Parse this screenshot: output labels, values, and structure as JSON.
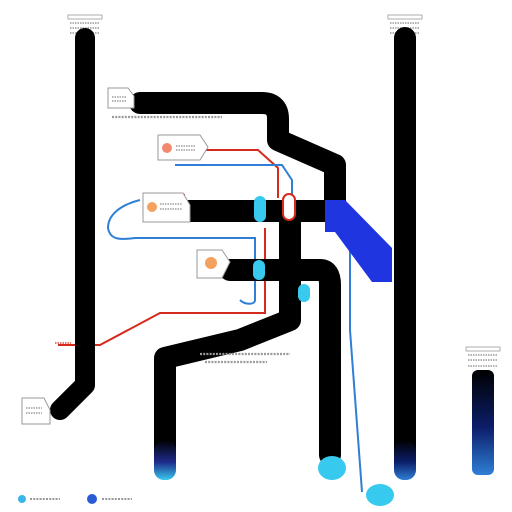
{
  "diagram": {
    "type": "pipe-routing-schematic",
    "colors": {
      "background": "#ffffff",
      "pipe": "#000000",
      "manifold": "#1f35e0",
      "red_line": "#d62a1c",
      "blue_line": "#2f7fd6",
      "cyan_valve": "#38c9ee",
      "label_text": "#8a8a8a",
      "card_border": "#9a9a9a",
      "node_salmon": "#f08a6c",
      "node_orange": "#f5a15e",
      "legend_cyan": "#3bb6ea",
      "legend_blue": "#2a5bd6"
    },
    "texts": {
      "corner_note": "",
      "left_note": "",
      "mid_caption": "",
      "legend_item_1": "",
      "legend_item_2": ""
    },
    "icons": [
      "column-cap-icon",
      "label-card-icon",
      "node-dot-icon",
      "valve-icon",
      "legend-dot-icon"
    ]
  }
}
